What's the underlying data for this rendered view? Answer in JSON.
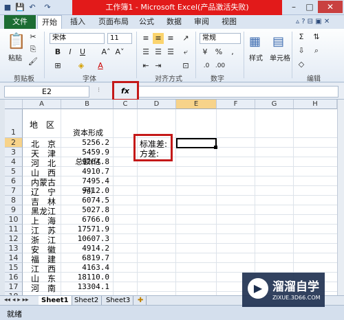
{
  "title": "工作簿1 - Microsoft Excel(产品激活失败)",
  "qat": [
    "💾",
    "↶",
    "↷"
  ],
  "tabs": {
    "file": "文件",
    "home": "开始",
    "insert": "插入",
    "layout": "页面布局",
    "formula": "公式",
    "data": "数据",
    "review": "审阅",
    "view": "视图"
  },
  "ribbon": {
    "paste": "粘贴",
    "clipboard": "剪贴板",
    "font_name": "宋体",
    "font_size": "11",
    "font": "字体",
    "bold": "B",
    "italic": "I",
    "underline": "U",
    "alignment": "对齐方式",
    "number_format": "常规",
    "number": "数字",
    "styles": "样式",
    "cells": "单元格",
    "editing": "编辑"
  },
  "namebox": "E2",
  "fx": "fx",
  "columns": [
    "A",
    "B",
    "C",
    "D",
    "E",
    "F",
    "G",
    "H"
  ],
  "rows": [
    "1",
    "2",
    "3",
    "4",
    "5",
    "6",
    "7",
    "8",
    "9",
    "10",
    "11",
    "12",
    "13",
    "14",
    "15",
    "16",
    "17",
    "18"
  ],
  "header_a": "地　区",
  "header_b": [
    "资本形成",
    "总额(亿",
    "元)"
  ],
  "data": [
    {
      "region": "北　京",
      "value": "5256.2"
    },
    {
      "region": "天　津",
      "value": "5459.9"
    },
    {
      "region": "河　北",
      "value": "9264.8"
    },
    {
      "region": "山　西",
      "value": "4910.7"
    },
    {
      "region": "内蒙古",
      "value": "7495.4"
    },
    {
      "region": "辽　宁",
      "value": "9412.0"
    },
    {
      "region": "吉　林",
      "value": "6074.5"
    },
    {
      "region": "黑龙江",
      "value": "5027.8"
    },
    {
      "region": "上　海",
      "value": "6766.0"
    },
    {
      "region": "江　苏",
      "value": "17571.9"
    },
    {
      "region": "浙　江",
      "value": "10607.3"
    },
    {
      "region": "安　徽",
      "value": "4914.2"
    },
    {
      "region": "福　建",
      "value": "6819.7"
    },
    {
      "region": "江　西",
      "value": "4163.4"
    },
    {
      "region": "山　东",
      "value": "18110.0"
    },
    {
      "region": "河　南",
      "value": "13304.1"
    }
  ],
  "labels": [
    "标准差:",
    "方差:"
  ],
  "sheets": [
    "Sheet1",
    "Sheet2",
    "Sheet3"
  ],
  "status": "就绪",
  "watermark": {
    "brand": "溜溜自学",
    "url": "ZIXUE.3D66.COM"
  }
}
